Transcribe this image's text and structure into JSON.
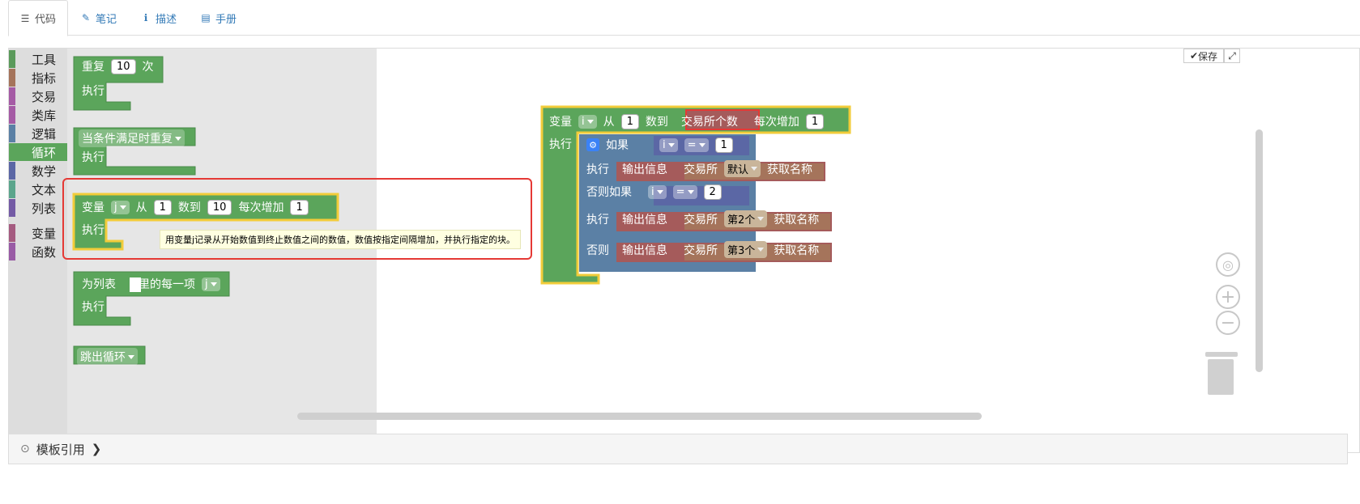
{
  "tabs": [
    {
      "label": "代码",
      "icon": "list-icon",
      "active": true
    },
    {
      "label": "笔记",
      "icon": "edit-icon"
    },
    {
      "label": "描述",
      "icon": "info-icon"
    },
    {
      "label": "手册",
      "icon": "book-icon"
    }
  ],
  "toolbox": {
    "categories": [
      {
        "label": "工具",
        "color": "#5b9a5b"
      },
      {
        "label": "指标",
        "color": "#a5745b"
      },
      {
        "label": "交易",
        "color": "#a55ba5"
      },
      {
        "label": "类库",
        "color": "#a55ba5"
      },
      {
        "label": "逻辑",
        "color": "#5b80a5"
      },
      {
        "label": "循环",
        "color": "#5ba55b",
        "selected": true
      },
      {
        "label": "数学",
        "color": "#5b67a5"
      },
      {
        "label": "文本",
        "color": "#5ba58c"
      },
      {
        "label": "列表",
        "color": "#745ba5"
      },
      {
        "label": "变量",
        "color": "#a55b80"
      },
      {
        "label": "函数",
        "color": "#995ba5"
      }
    ]
  },
  "flyout": {
    "repeat": {
      "label": "重复",
      "count": "10",
      "times": "次",
      "do": "执行"
    },
    "while": {
      "label": "当条件满足时重复",
      "do": "执行"
    },
    "for": {
      "var_label": "变量",
      "var": "j",
      "from": "从",
      "start": "1",
      "to": "数到",
      "end": "10",
      "step_label": "每次增加",
      "step": "1",
      "do": "执行"
    },
    "foreach": {
      "label": "为列表",
      "each": "里的每一项",
      "var": "j",
      "do": "执行"
    },
    "break": {
      "label": "跳出循环"
    }
  },
  "tooltip": "用变量j记录从开始数值到终止数值之间的数值，数值按指定间隔增加，并执行指定的块。",
  "canvas": {
    "for": {
      "var_label": "变量",
      "var": "i",
      "from": "从",
      "start": "1",
      "to": "数到",
      "end": "交易所个数",
      "step_label": "每次增加",
      "step": "1",
      "do": "执行"
    },
    "if": {
      "if_label": "如果",
      "cond1": {
        "var": "i",
        "op": "=",
        "val": "1"
      },
      "do1": "执行",
      "print1": {
        "label": "输出信息",
        "exchange": "交易所",
        "choice": "默认",
        "method": "获取名称"
      },
      "elseif_label": "否则如果",
      "cond2": {
        "var": "i",
        "op": "=",
        "val": "2"
      },
      "do2": "执行",
      "print2": {
        "label": "输出信息",
        "exchange": "交易所",
        "choice": "第2个",
        "method": "获取名称"
      },
      "else_label": "否则",
      "print3": {
        "label": "输出信息",
        "exchange": "交易所",
        "choice": "第3个",
        "method": "获取名称"
      }
    }
  },
  "controls": {
    "save": "保存"
  },
  "bottom": {
    "label": "模板引用"
  },
  "colors": {
    "loop": "#5ba55b",
    "logic": "#5b80a5",
    "io": "#a55b5b",
    "exchange": "#a5745b",
    "highlight": "#f2cc3a"
  }
}
